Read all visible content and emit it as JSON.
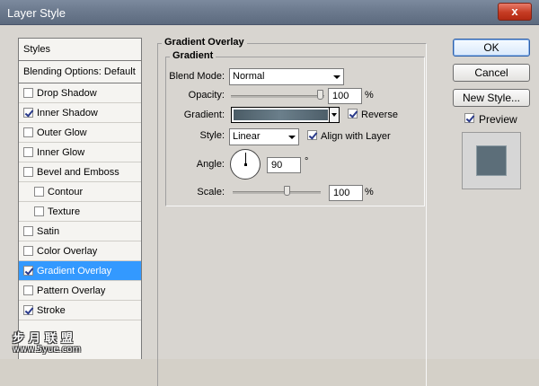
{
  "window": {
    "title": "Layer Style",
    "close_label": "x"
  },
  "styles_list": {
    "header": "Styles",
    "blending": "Blending Options: Default",
    "items": [
      {
        "label": "Drop Shadow",
        "checked": false
      },
      {
        "label": "Inner Shadow",
        "checked": true
      },
      {
        "label": "Outer Glow",
        "checked": false
      },
      {
        "label": "Inner Glow",
        "checked": false
      },
      {
        "label": "Bevel and Emboss",
        "checked": false
      },
      {
        "label": "Contour",
        "checked": false
      },
      {
        "label": "Texture",
        "checked": false
      },
      {
        "label": "Satin",
        "checked": false
      },
      {
        "label": "Color Overlay",
        "checked": false
      },
      {
        "label": "Gradient Overlay",
        "checked": true
      },
      {
        "label": "Pattern Overlay",
        "checked": false
      },
      {
        "label": "Stroke",
        "checked": true
      }
    ]
  },
  "gradient_overlay": {
    "group_title": "Gradient Overlay",
    "subgroup_title": "Gradient",
    "blend_mode": {
      "label": "Blend Mode:",
      "value": "Normal"
    },
    "opacity": {
      "label": "Opacity:",
      "value": "100",
      "unit": "%",
      "level": 1.0
    },
    "gradient": {
      "label": "Gradient:",
      "reverse_label": "Reverse",
      "reverse_checked": true,
      "colors": [
        "#4b5c66",
        "#6b7f8b",
        "#4d5e69"
      ]
    },
    "style": {
      "label": "Style:",
      "value": "Linear",
      "align_label": "Align with Layer",
      "align_checked": true
    },
    "angle": {
      "label": "Angle:",
      "value": "90",
      "unit": "°"
    },
    "scale": {
      "label": "Scale:",
      "value": "100",
      "unit": "%"
    }
  },
  "buttons": {
    "ok": "OK",
    "cancel": "Cancel",
    "new_style": "New Style..."
  },
  "preview": {
    "label": "Preview",
    "checked": true,
    "swatch_color": "#5c6e79"
  },
  "watermark": {
    "cn": "步月联盟",
    "url": "www.5yue.com"
  }
}
